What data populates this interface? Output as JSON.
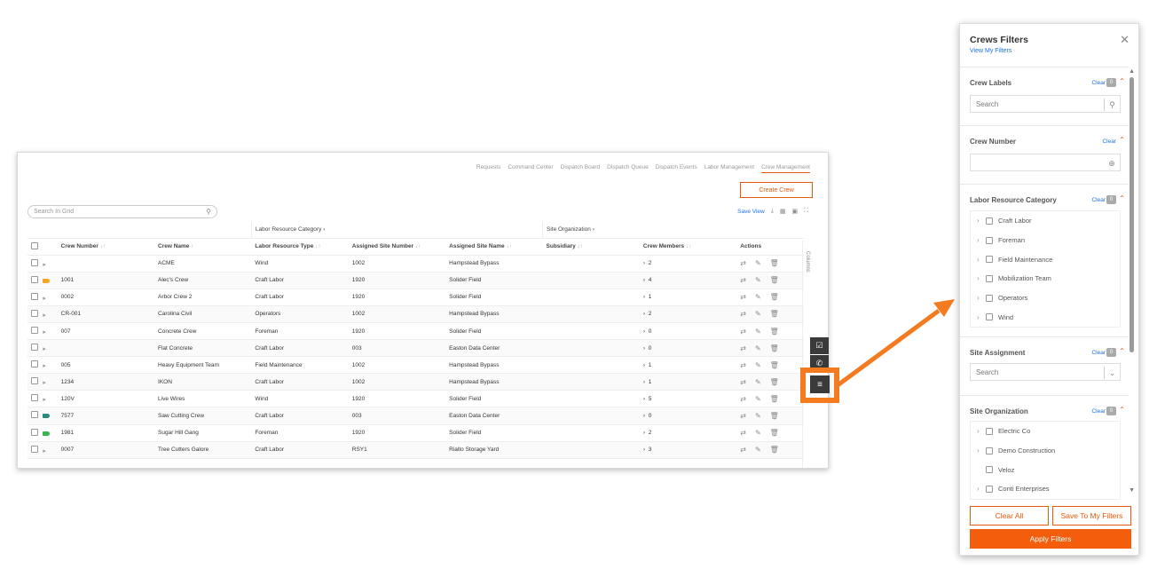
{
  "nav": [
    "Requests",
    "Command Center",
    "Dispatch Board",
    "Dispatch Queue",
    "Dispatch Events",
    "Labor Management",
    "Crew Management"
  ],
  "nav_active": "Crew Management",
  "create_label": "Create Crew",
  "search_placeholder": "Search In Grid",
  "save_view": "Save View",
  "columns_label": "Columns",
  "groups": {
    "labor": "Labor Resource Category",
    "site": "Site Organization"
  },
  "headers": [
    "Crew Number",
    "Crew Name",
    "Labor Resource Type",
    "Assigned Site Number",
    "Assigned Site Name",
    "Subsidiary",
    "Crew Members",
    "Actions"
  ],
  "rows": [
    {
      "tag": "none",
      "num": "",
      "name": "ACME",
      "type": "Wind",
      "site_no": "1002",
      "site": "Hampstead Bypass",
      "sub": "",
      "members": "2"
    },
    {
      "tag": "#f5a623",
      "num": "1001",
      "name": "Alec's Crew",
      "type": "Craft Labor",
      "site_no": "1920",
      "site": "Solider Field",
      "sub": "",
      "members": "4"
    },
    {
      "tag": "none",
      "num": "0002",
      "name": "Arbor Crew 2",
      "type": "Craft Labor",
      "site_no": "1920",
      "site": "Solider Field",
      "sub": "",
      "members": "1"
    },
    {
      "tag": "none",
      "num": "CR-001",
      "name": "Carolina Civil",
      "type": "Operators",
      "site_no": "1002",
      "site": "Hampstead Bypass",
      "sub": "",
      "members": "2"
    },
    {
      "tag": "none",
      "num": "007",
      "name": "Concrete Crew",
      "type": "Foreman",
      "site_no": "1920",
      "site": "Solider Field",
      "sub": "",
      "members": "0"
    },
    {
      "tag": "none",
      "num": "",
      "name": "Flat Concrete",
      "type": "Craft Labor",
      "site_no": "003",
      "site": "Easton Data Center",
      "sub": "",
      "members": "0"
    },
    {
      "tag": "none",
      "num": "005",
      "name": "Heavy Equipment Team",
      "type": "Field Maintenance",
      "site_no": "1002",
      "site": "Hampstead Bypass",
      "sub": "",
      "members": "1"
    },
    {
      "tag": "none",
      "num": "1234",
      "name": "IKON",
      "type": "Craft Labor",
      "site_no": "1002",
      "site": "Hampstead Bypass",
      "sub": "",
      "members": "1"
    },
    {
      "tag": "none",
      "num": "120V",
      "name": "Live Wires",
      "type": "Wind",
      "site_no": "1920",
      "site": "Solider Field",
      "sub": "",
      "members": "5"
    },
    {
      "tag": "#2a8c7a",
      "num": "7577",
      "name": "Saw Cutting Crew",
      "type": "Craft Labor",
      "site_no": "003",
      "site": "Easton Data Center",
      "sub": "",
      "members": "0"
    },
    {
      "tag": "#3cb54a",
      "num": "1981",
      "name": "Sugar Hill Gang",
      "type": "Foreman",
      "site_no": "1920",
      "site": "Solider Field",
      "sub": "",
      "members": "2"
    },
    {
      "tag": "none",
      "num": "0007",
      "name": "Tree Cutters Galore",
      "type": "Craft Labor",
      "site_no": "RSY1",
      "site": "Rialto Storage Yard",
      "sub": "",
      "members": "3"
    }
  ],
  "panel": {
    "title": "Crews Filters",
    "view_filters": "View My Filters",
    "crew_labels": {
      "title": "Crew Labels",
      "clear": "Clear",
      "count": "0",
      "search": "Search"
    },
    "crew_number": {
      "title": "Crew Number",
      "clear": "Clear"
    },
    "labor": {
      "title": "Labor Resource Category",
      "clear": "Clear",
      "count": "0",
      "items": [
        "Craft Labor",
        "Foreman",
        "Field Maintenance",
        "Mobilization Team",
        "Operators",
        "Wind"
      ]
    },
    "site_assign": {
      "title": "Site Assignment",
      "clear": "Clear",
      "count": "0",
      "search": "Search"
    },
    "site_org": {
      "title": "Site Organization",
      "clear": "Clear",
      "count": "0",
      "items": [
        {
          "label": "Electric Co",
          "chev": true
        },
        {
          "label": "Demo Construction",
          "chev": true
        },
        {
          "label": "Veloz",
          "chev": false
        },
        {
          "label": "Conti Enterprises",
          "chev": true
        }
      ]
    },
    "clear_all": "Clear All",
    "save_filters": "Save To My Filters",
    "apply": "Apply Filters"
  },
  "colors": {
    "accent": "#f35d0c",
    "link": "#1a73e8",
    "highlight": "#f47b20"
  }
}
